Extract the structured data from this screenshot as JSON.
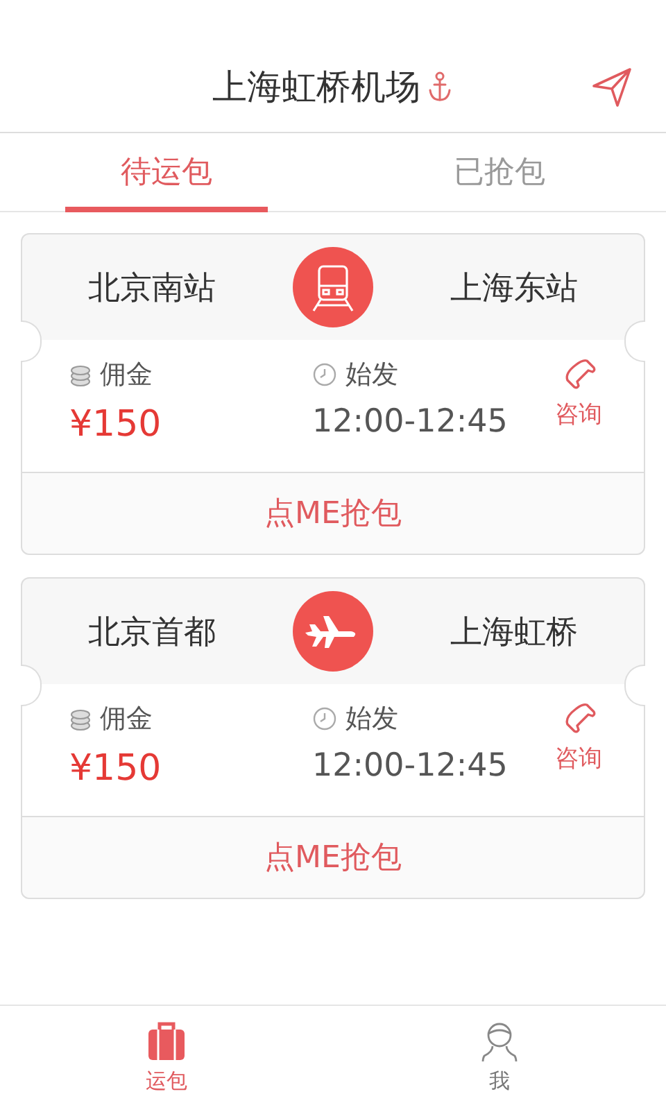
{
  "header": {
    "title": "上海虹桥机场"
  },
  "tabs": [
    {
      "label": "待运包",
      "selected": true
    },
    {
      "label": "已抢包",
      "selected": false
    }
  ],
  "orders": [
    {
      "kind": "train",
      "from": "北京南站",
      "to": "上海东站",
      "fee_label": "佣金",
      "fee": "¥150",
      "depart_label": "始发",
      "time": "12:00-12:45",
      "consult": "咨询",
      "action": "点ME抢包"
    },
    {
      "kind": "plane",
      "from": "北京首都",
      "to": "上海虹桥",
      "fee_label": "佣金",
      "fee": "¥150",
      "depart_label": "始发",
      "time": "12:00-12:45",
      "consult": "咨询",
      "action": "点ME抢包"
    }
  ],
  "bottom_nav": [
    {
      "kind": "bag",
      "label": "运包",
      "selected": true
    },
    {
      "kind": "person",
      "label": "我",
      "selected": false
    }
  ]
}
